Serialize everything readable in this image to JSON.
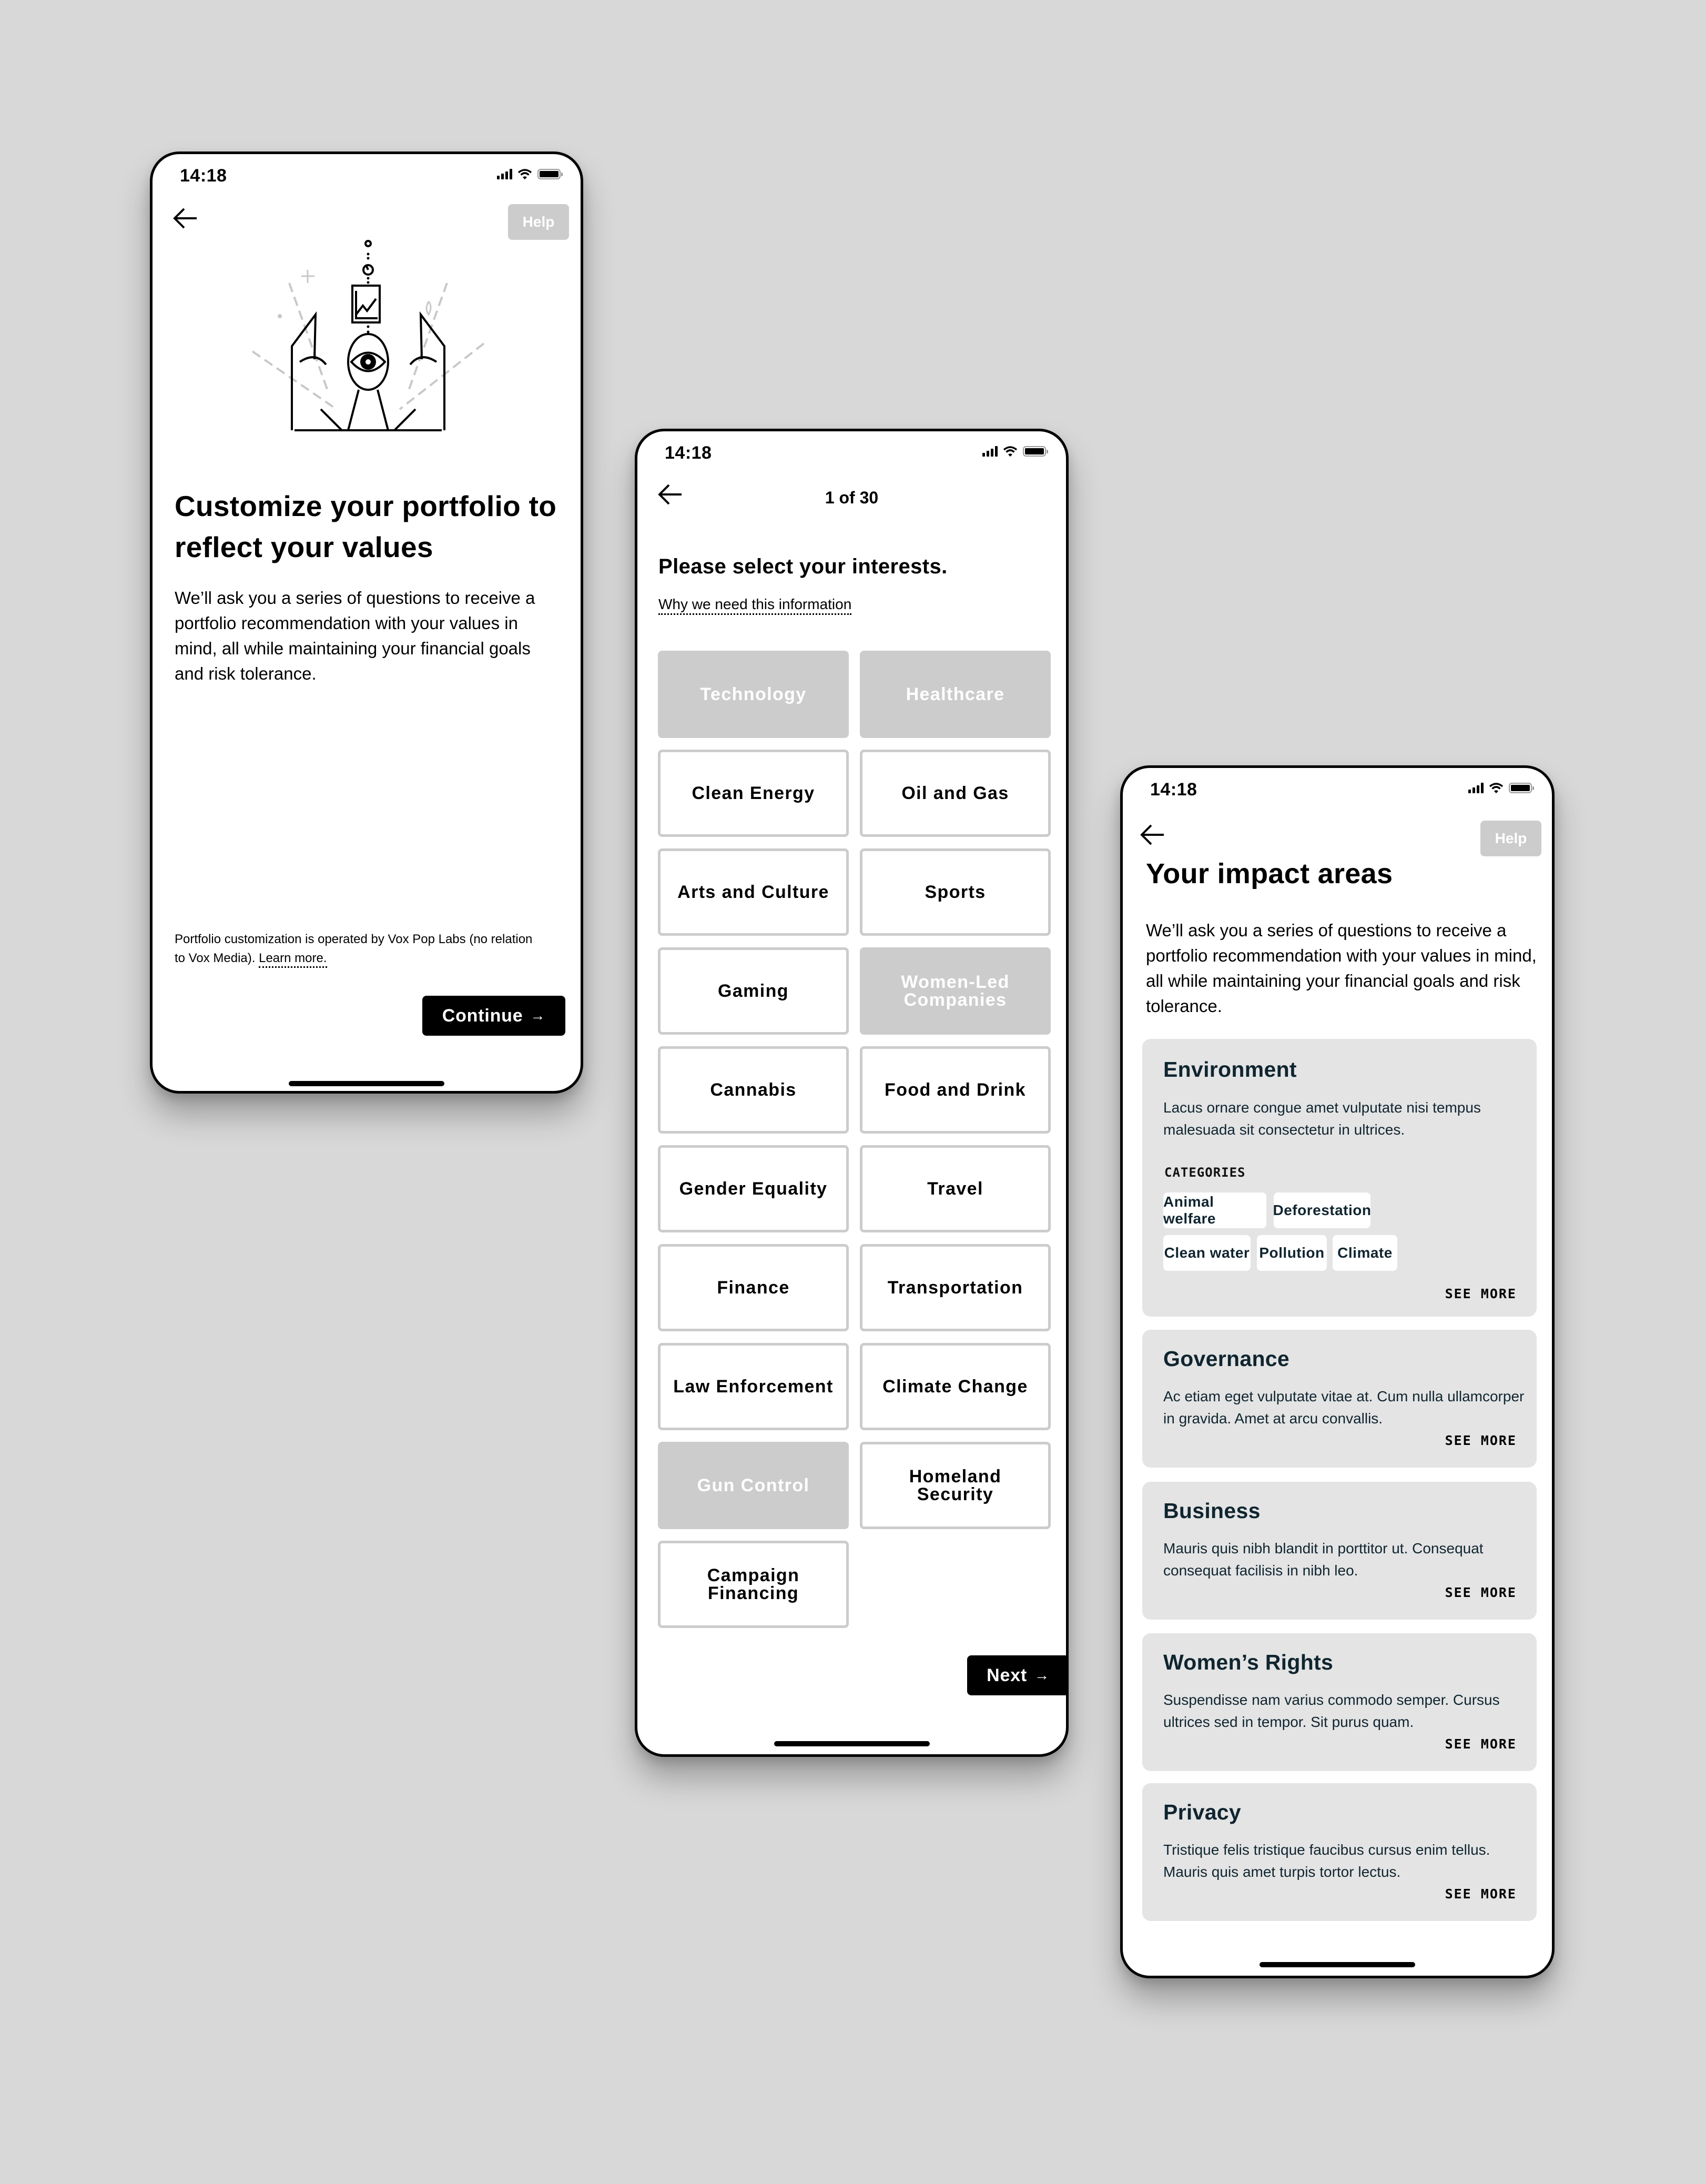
{
  "colors": {
    "background": "#d8d8d8",
    "selected_tile": "#cccccc",
    "card_bg": "#e4e4e4",
    "primary_btn": "#000000",
    "help_btn": "#cccccc",
    "card_text": "#0f2530"
  },
  "status_bar": {
    "time": "14:18",
    "icons": [
      "signal-icon",
      "wifi-icon",
      "battery-icon"
    ]
  },
  "screen_intro": {
    "back_icon": "arrow-left-icon",
    "help_label": "Help",
    "illustration": "crystal-ball-eye-hands-illustration",
    "title": "Customize your portfolio to reflect your values",
    "body": "We’ll ask you a series of questions to receive a portfolio recommendation with your values in mind, all while maintaining your financial goals and risk tolerance.",
    "footnote": "Portfolio customization is operated by Vox Pop Labs (no relation to Vox Media).",
    "footnote_link": "Learn more.",
    "continue_label": "Continue",
    "continue_icon": "arrow-right-icon"
  },
  "screen_interests": {
    "back_icon": "arrow-left-icon",
    "progress": "1 of 30",
    "question": "Please select your interests.",
    "why_link": "Why we need this information",
    "tiles": [
      {
        "label": "Technology",
        "selected": true
      },
      {
        "label": "Healthcare",
        "selected": true
      },
      {
        "label": "Clean Energy",
        "selected": false
      },
      {
        "label": "Oil and Gas",
        "selected": false
      },
      {
        "label": "Arts and Culture",
        "selected": false
      },
      {
        "label": "Sports",
        "selected": false
      },
      {
        "label": "Gaming",
        "selected": false
      },
      {
        "label": "Women-Led Companies",
        "selected": true
      },
      {
        "label": "Cannabis",
        "selected": false
      },
      {
        "label": "Food and Drink",
        "selected": false
      },
      {
        "label": "Gender Equality",
        "selected": false
      },
      {
        "label": "Travel",
        "selected": false
      },
      {
        "label": "Finance",
        "selected": false
      },
      {
        "label": "Transportation",
        "selected": false
      },
      {
        "label": "Law Enforcement",
        "selected": false
      },
      {
        "label": "Climate Change",
        "selected": false
      },
      {
        "label": "Gun Control",
        "selected": true
      },
      {
        "label": "Homeland Security",
        "selected": false
      },
      {
        "label": "Campaign Financing",
        "selected": false
      }
    ],
    "next_label": "Next",
    "next_icon": "arrow-right-icon"
  },
  "screen_impact": {
    "back_icon": "arrow-left-icon",
    "help_label": "Help",
    "title": "Your impact areas",
    "body": "We’ll ask you a series of questions to receive a portfolio recommendation with your values in mind, all while maintaining your financial goals and risk tolerance.",
    "cards": [
      {
        "title": "Environment",
        "description": "Lacus ornare congue amet vulputate nisi tempus malesuada sit consectetur in ultrices.",
        "categories_label": "CATEGORIES",
        "categories": [
          "Animal welfare",
          "Deforestation",
          "Clean water",
          "Pollution",
          "Climate"
        ],
        "see_more": "SEE MORE"
      },
      {
        "title": "Governance",
        "description": "Ac etiam eget vulputate vitae at. Cum nulla ullamcorper in gravida. Amet at arcu convallis.",
        "see_more": "SEE MORE"
      },
      {
        "title": "Business",
        "description": "Mauris quis nibh blandit in porttitor ut. Consequat consequat facilisis in nibh leo.",
        "see_more": "SEE MORE"
      },
      {
        "title": "Women’s Rights",
        "description": "Suspendisse nam varius commodo semper. Cursus ultrices sed in tempor. Sit purus quam.",
        "see_more": "SEE MORE"
      },
      {
        "title": "Privacy",
        "description": "Tristique felis tristique faucibus cursus enim tellus. Mauris quis amet turpis tortor lectus.",
        "see_more": "SEE MORE"
      }
    ]
  }
}
